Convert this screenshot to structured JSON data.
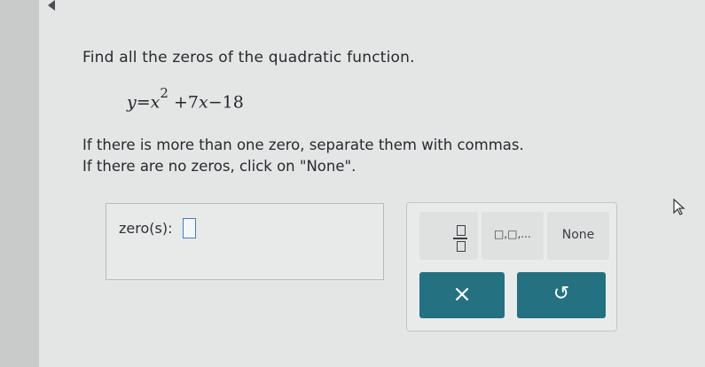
{
  "problem": {
    "question": "Find all the zeros of the quadratic function.",
    "equation": {
      "y": "y",
      "equals": "=",
      "x": "x",
      "exponent": "2",
      "term2": "+7",
      "term2_var": "x",
      "term3": "−18"
    },
    "instruction1": "If there is more than one zero, separate them with commas.",
    "instruction2": "If there are no zeros, click on \"None\"."
  },
  "answer": {
    "label": "zero(s):",
    "value": ""
  },
  "keypad": {
    "list_glyph": "□,□,...",
    "none_label": "None",
    "clear_glyph": "×",
    "undo_glyph": "↺"
  },
  "colors": {
    "accent": "#237181",
    "input_border": "#3f7ec8"
  }
}
